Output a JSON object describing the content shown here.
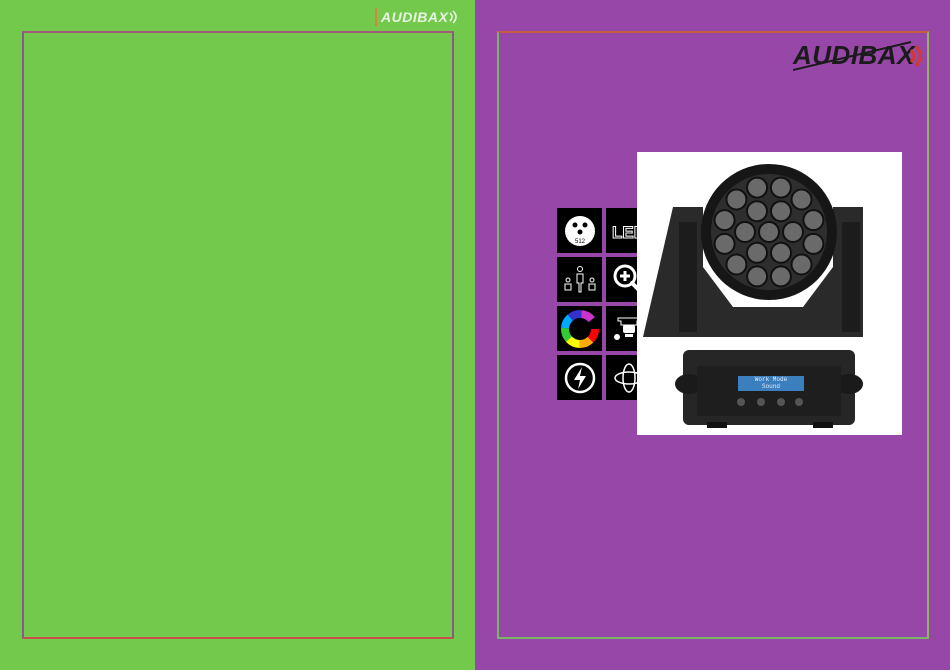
{
  "left_page": {
    "background": "#72c94c",
    "logo_text": "AUDIBAX"
  },
  "right_page": {
    "background": "#9747a8",
    "logo_text": "AUDIBAX",
    "icons": [
      {
        "name": "dmx-512-icon",
        "label": "512"
      },
      {
        "name": "led-icon",
        "label": "LED"
      },
      {
        "name": "people-icon",
        "label": ""
      },
      {
        "name": "zoom-icon",
        "label": ""
      },
      {
        "name": "color-wheel-icon",
        "label": ""
      },
      {
        "name": "moving-head-icon",
        "label": ""
      },
      {
        "name": "power-icon",
        "label": ""
      },
      {
        "name": "rotation-icon",
        "label": ""
      }
    ],
    "product": {
      "display_line1": "Work Mode",
      "display_line2": "Sound"
    }
  }
}
